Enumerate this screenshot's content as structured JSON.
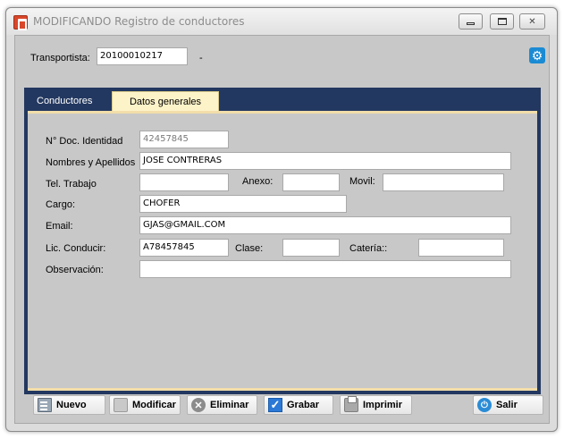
{
  "window": {
    "title": "MODIFICANDO Registro de conductores",
    "controls": {
      "minimize_icon": "minimize-icon",
      "maximize_icon": "maximize-icon",
      "close_label": "✕"
    }
  },
  "header": {
    "transportista_label": "Transportista:",
    "transportista_value": "20100010217",
    "separator": "-",
    "settings_icon": "gear-icon"
  },
  "tabs": {
    "conductores": "Conductores",
    "datos_generales": "Datos generales",
    "active": "Datos generales"
  },
  "form": {
    "doc_label": "N° Doc. Identidad",
    "doc_value": "42457845",
    "nombres_label": "Nombres y Apellidos",
    "nombres_value": "JOSE CONTRERAS",
    "tel_label": "Tel. Trabajo",
    "tel_value": "",
    "anexo_label": "Anexo:",
    "anexo_value": "",
    "movil_label": "Movil:",
    "movil_value": "",
    "cargo_label": "Cargo:",
    "cargo_value": "CHOFER",
    "email_label": "Email:",
    "email_value": "GJAS@GMAIL.COM",
    "lic_label": "Lic. Conducir:",
    "lic_value": "A78457845",
    "clase_label": "Clase:",
    "clase_value": "",
    "categoria_label": "Catería::",
    "categoria_value": "",
    "observacion_label": "Observación:",
    "observacion_value": ""
  },
  "toolbar": {
    "nuevo": "Nuevo",
    "modificar": "Modificar",
    "eliminar": "Eliminar",
    "grabar": "Grabar",
    "imprimir": "Imprimir",
    "salir": "Salir"
  }
}
